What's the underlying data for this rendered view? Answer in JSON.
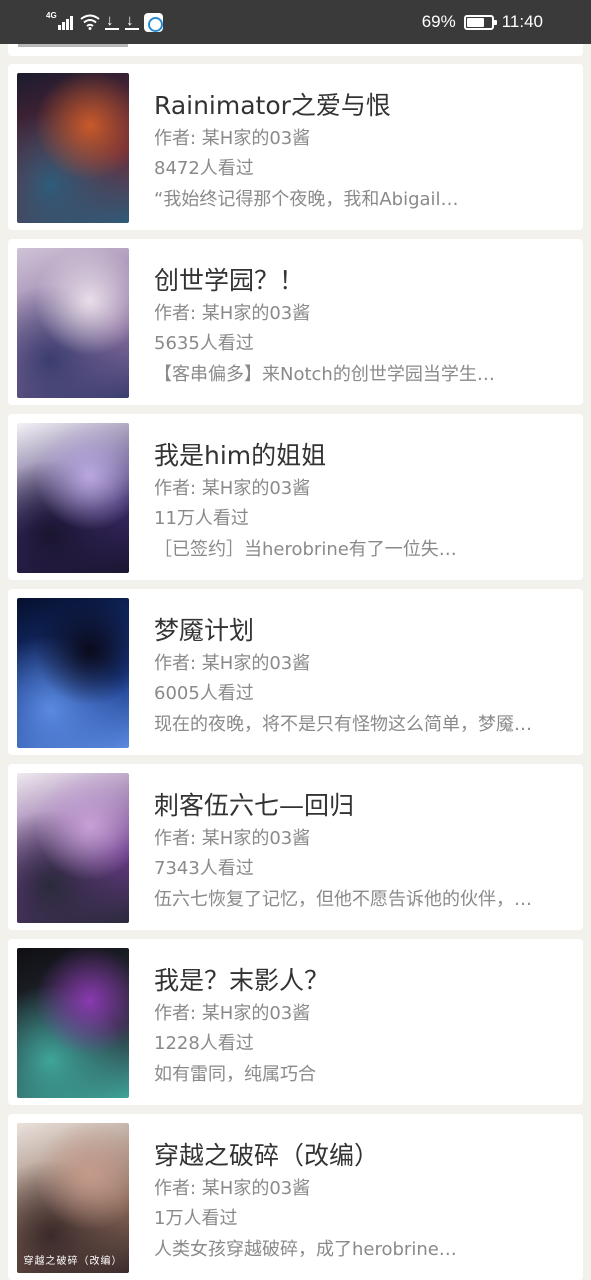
{
  "status_bar": {
    "network": "4G",
    "battery_percent": "69%",
    "battery_level": 0.69,
    "time": "11:40"
  },
  "books": [
    {
      "title": "Rainimator之爱与恨",
      "author": "作者: 某H家的03酱",
      "views": "8472人看过",
      "desc": "“我始终记得那个夜晚，我和Abigail…",
      "cover_colors": [
        "#1b1b2e",
        "#6a2a3a",
        "#2d5c7a",
        "#c85a2a"
      ]
    },
    {
      "title": "创世学园？！",
      "author": "作者: 某H家的03酱",
      "views": "5635人看过",
      "desc": "【客串偏多】来Notch的创世学园当学生…",
      "cover_colors": [
        "#cfc3d6",
        "#8a6fa0",
        "#3a3d6e",
        "#e8dfe8"
      ]
    },
    {
      "title": "我是him的姐姐",
      "author": "作者: 某H家的03酱",
      "views": "11万人看过",
      "desc": "［已签约］当herobrine有了一位失…",
      "cover_colors": [
        "#f4f2f7",
        "#3b2a6a",
        "#1a1530",
        "#b9a8e0"
      ]
    },
    {
      "title": "梦魇计划",
      "author": "作者: 某H家的03酱",
      "views": "6005人看过",
      "desc": "现在的夜晚，将不是只有怪物这么简单，梦魇…",
      "cover_colors": [
        "#06102e",
        "#1a3a8a",
        "#5a8ae0",
        "#0a0a1a"
      ]
    },
    {
      "title": "刺客伍六七—回归",
      "author": "作者: 某H家的03酱",
      "views": "7343人看过",
      "desc": "伍六七恢复了记忆，但他不愿告诉他的伙伴，…",
      "cover_colors": [
        "#efe9ef",
        "#6a3a8a",
        "#2a2a3a",
        "#c6a0d6"
      ]
    },
    {
      "title": "我是？末影人？",
      "author": "作者: 某H家的03酱",
      "views": "1228人看过",
      "desc": "如有雷同，纯属巧合",
      "cover_colors": [
        "#0f0f14",
        "#2a2f3a",
        "#3ea59a",
        "#8a3ab0"
      ]
    },
    {
      "title": "穿越之破碎（改编）",
      "author": "作者: 某H家的03酱",
      "views": "1万人看过",
      "desc": "人类女孩穿越破碎，成了herobrine…",
      "cover_colors": [
        "#eae2dc",
        "#8a6a5a",
        "#3a2a2a",
        "#c49a8a"
      ],
      "cover_text": "穿越之破碎（改编）"
    }
  ]
}
